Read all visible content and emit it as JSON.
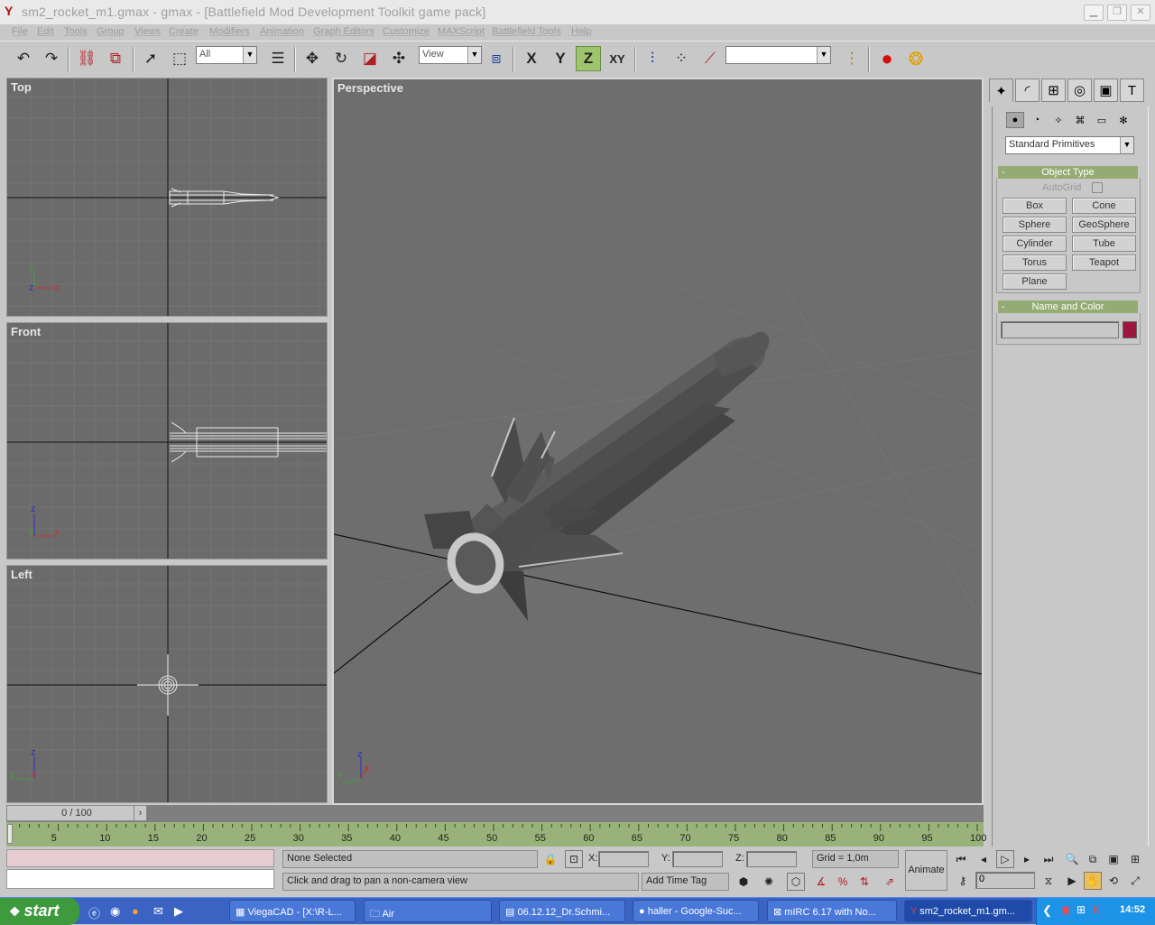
{
  "window": {
    "title": "sm2_rocket_m1.gmax - gmax - [Battlefield Mod Development Toolkit game pack]",
    "controls": [
      "minimize",
      "restore",
      "close"
    ]
  },
  "menubar": {
    "items": [
      "File",
      "Edit",
      "Tools",
      "Group",
      "Views",
      "Create",
      "Modifiers",
      "Animation",
      "Graph Editors",
      "Customize",
      "MAXScript",
      "Battlefield Tools",
      "Help"
    ]
  },
  "toolbar": {
    "selection_filter": "All",
    "reference_coord": "View",
    "axis_x": "X",
    "axis_y": "Y",
    "axis_z": "Z",
    "axis_xy": "XY",
    "named_selection": ""
  },
  "viewports": {
    "top": {
      "label": "Top",
      "axis1": "y",
      "axis2": "x",
      "axis3": "z"
    },
    "front": {
      "label": "Front",
      "axis1": "z",
      "axis2": "x",
      "axis3": "y"
    },
    "left": {
      "label": "Left",
      "axis1": "z",
      "axis2": "x",
      "axis3": "y"
    },
    "perspective": {
      "label": "Perspective",
      "axis1": "z",
      "axis2": "x",
      "axis3": "y"
    }
  },
  "command_panel": {
    "category_dropdown": "Standard Primitives",
    "object_type": {
      "header": "Object Type",
      "autogrid_label": "AutoGrid",
      "buttons": [
        "Box",
        "Cone",
        "Sphere",
        "GeoSphere",
        "Cylinder",
        "Tube",
        "Torus",
        "Teapot",
        "Plane"
      ]
    },
    "name_color": {
      "header": "Name and Color",
      "name_value": "",
      "color": "#a0153e"
    }
  },
  "timeline": {
    "frame_display": "0 / 100",
    "ticks": [
      "5",
      "10",
      "15",
      "20",
      "25",
      "30",
      "35",
      "40",
      "45",
      "50",
      "55",
      "60",
      "65",
      "70",
      "75",
      "80",
      "85",
      "90",
      "95",
      "100"
    ]
  },
  "status": {
    "selection": "None Selected",
    "prompt": "Click and drag to pan a non-camera view",
    "x_label": "X:",
    "y_label": "Y:",
    "z_label": "Z:",
    "x_value": "",
    "y_value": "",
    "z_value": "",
    "grid": "Grid = 1,0m",
    "add_time_tag": "Add Time Tag",
    "animate": "Animate",
    "current_frame": "0"
  },
  "taskbar": {
    "start": "start",
    "tasks": [
      "ViegaCAD - [X:\\R-L...",
      "Air",
      "06.12.12_Dr.Schmi...",
      "haller - Google-Suc...",
      "mIRC 6.17 with No...",
      "sm2_rocket_m1.gm..."
    ],
    "clock": "14:52"
  },
  "colors": {
    "viewport_bg": "#6b6b6b",
    "accent_green": "#94ab73",
    "taskbar_blue": "#3b63c4"
  }
}
